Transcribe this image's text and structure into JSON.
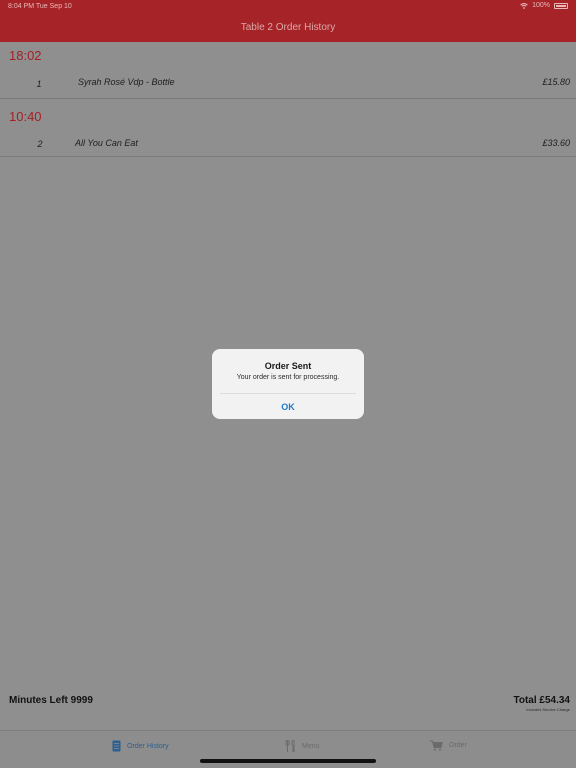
{
  "status_bar": {
    "time": "8:04 PM  Tue Sep 10",
    "battery": "100%"
  },
  "header": {
    "title": "Table 2 Order History"
  },
  "orders": [
    {
      "time": "18:02",
      "items": [
        {
          "qty": "1",
          "name": "Syrah Rosé Vdp - Bottle",
          "price": "£15.80"
        }
      ]
    },
    {
      "time": "10:40",
      "items": [
        {
          "qty": "2",
          "name": "All You Can Eat",
          "price": "£33.60"
        }
      ]
    }
  ],
  "footer": {
    "minutes_left": "Minutes Left 9999",
    "total": "Total £54.34",
    "service_note": "Includes Service Charge"
  },
  "tabs": [
    {
      "label": "Order History",
      "icon": "document-icon",
      "active": true
    },
    {
      "label": "Menu",
      "icon": "fork-knife-icon",
      "active": false
    },
    {
      "label": "Order",
      "icon": "cart-icon",
      "active": false
    }
  ],
  "dialog": {
    "title": "Order Sent",
    "message": "Your order is sent for processing.",
    "ok_label": "OK"
  },
  "colors": {
    "header_bg": "#a62428",
    "accent_red": "#a51f24",
    "tab_active": "#2c5f93",
    "dialog_button": "#1f7ac9"
  }
}
